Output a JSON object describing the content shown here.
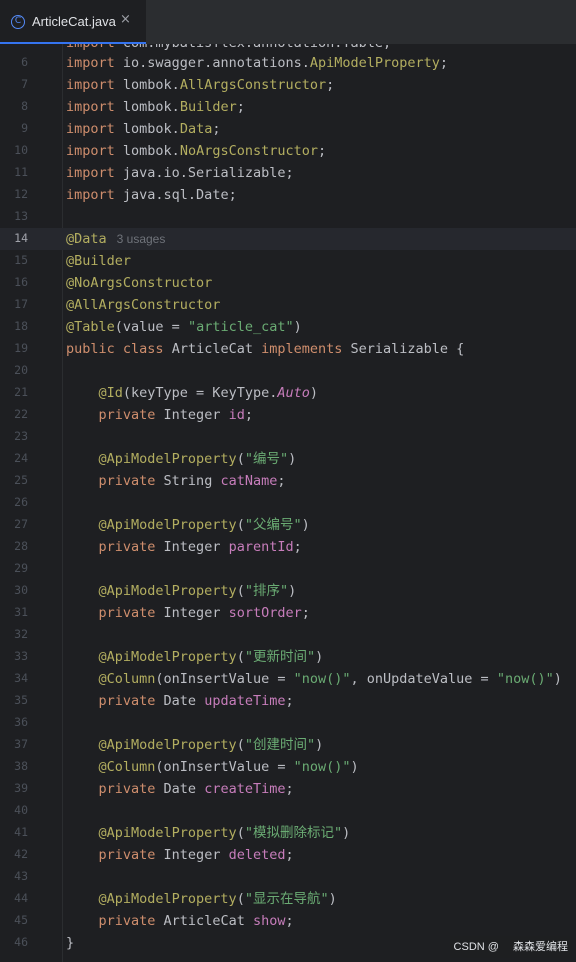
{
  "tab": {
    "icon": "class-icon",
    "icon_glyph": "C",
    "filename": "ArticleCat.java",
    "close_glyph": "×"
  },
  "editor": {
    "partial_top_line": "import com.mybatisflex.annotation.Table;",
    "current_line": 14,
    "usages_hint": "3 usages",
    "lines": [
      {
        "n": "6",
        "text": "import io.swagger.annotations.ApiModelProperty;"
      },
      {
        "n": "7",
        "text": "import lombok.AllArgsConstructor;"
      },
      {
        "n": "8",
        "text": "import lombok.Builder;"
      },
      {
        "n": "9",
        "text": "import lombok.Data;"
      },
      {
        "n": "10",
        "text": "import lombok.NoArgsConstructor;"
      },
      {
        "n": "11",
        "text": "import java.io.Serializable;"
      },
      {
        "n": "12",
        "text": "import java.sql.Date;"
      },
      {
        "n": "13",
        "text": ""
      },
      {
        "n": "14",
        "text": "@Data"
      },
      {
        "n": "15",
        "text": "@Builder"
      },
      {
        "n": "16",
        "text": "@NoArgsConstructor"
      },
      {
        "n": "17",
        "text": "@AllArgsConstructor"
      },
      {
        "n": "18",
        "text": "@Table(value = \"article_cat\")"
      },
      {
        "n": "19",
        "text": "public class ArticleCat implements Serializable {"
      },
      {
        "n": "20",
        "text": ""
      },
      {
        "n": "21",
        "text": "    @Id(keyType = KeyType.Auto)"
      },
      {
        "n": "22",
        "text": "    private Integer id;"
      },
      {
        "n": "23",
        "text": ""
      },
      {
        "n": "24",
        "text": "    @ApiModelProperty(\"编号\")"
      },
      {
        "n": "25",
        "text": "    private String catName;"
      },
      {
        "n": "26",
        "text": ""
      },
      {
        "n": "27",
        "text": "    @ApiModelProperty(\"父编号\")"
      },
      {
        "n": "28",
        "text": "    private Integer parentId;"
      },
      {
        "n": "29",
        "text": ""
      },
      {
        "n": "30",
        "text": "    @ApiModelProperty(\"排序\")"
      },
      {
        "n": "31",
        "text": "    private Integer sortOrder;"
      },
      {
        "n": "32",
        "text": ""
      },
      {
        "n": "33",
        "text": "    @ApiModelProperty(\"更新时间\")"
      },
      {
        "n": "34",
        "text": "    @Column(onInsertValue = \"now()\", onUpdateValue = \"now()\")"
      },
      {
        "n": "35",
        "text": "    private Date updateTime;"
      },
      {
        "n": "36",
        "text": ""
      },
      {
        "n": "37",
        "text": "    @ApiModelProperty(\"创建时间\")"
      },
      {
        "n": "38",
        "text": "    @Column(onInsertValue = \"now()\")"
      },
      {
        "n": "39",
        "text": "    private Date createTime;"
      },
      {
        "n": "40",
        "text": ""
      },
      {
        "n": "41",
        "text": "    @ApiModelProperty(\"模拟删除标记\")"
      },
      {
        "n": "42",
        "text": "    private Integer deleted;"
      },
      {
        "n": "43",
        "text": ""
      },
      {
        "n": "44",
        "text": "    @ApiModelProperty(\"显示在导航\")"
      },
      {
        "n": "45",
        "text": "    private ArticleCat show;"
      },
      {
        "n": "46",
        "text": "}"
      }
    ]
  },
  "watermark": "CSDN @ 　森森爱编程",
  "colors": {
    "background": "#1e1f22",
    "keyword": "#cf8e6d",
    "annotation": "#b3ae60",
    "string": "#6aab73",
    "field": "#c77dbb",
    "plain": "#bcbec4",
    "line_number": "#4b5059",
    "tab_underline": "#3574f0"
  }
}
